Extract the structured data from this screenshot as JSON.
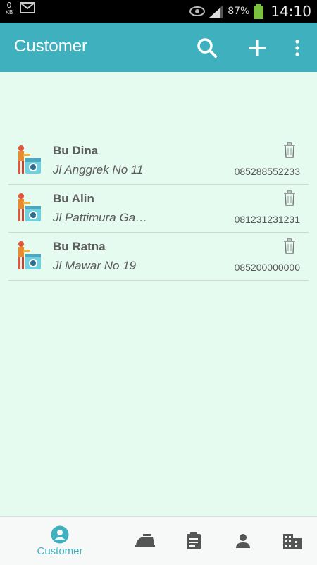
{
  "status_bar": {
    "data_amount": "0",
    "data_unit": "KB",
    "battery": "87%",
    "time": "14:10"
  },
  "app_bar": {
    "title": "Customer",
    "color": "#3fb0bd"
  },
  "customers": [
    {
      "name": "Bu Dina",
      "address": "Jl Anggrek No 11",
      "phone": "085288552233"
    },
    {
      "name": "Bu Alin",
      "address": "Jl Pattimura Ga…",
      "phone": "081231231231"
    },
    {
      "name": "Bu Ratna",
      "address": "Jl Mawar No 19",
      "phone": "085200000000"
    }
  ],
  "bottom_nav": {
    "active_label": "Customer",
    "items": [
      "customer-icon",
      "iron-icon",
      "clipboard-icon",
      "person-icon",
      "building-icon"
    ]
  }
}
